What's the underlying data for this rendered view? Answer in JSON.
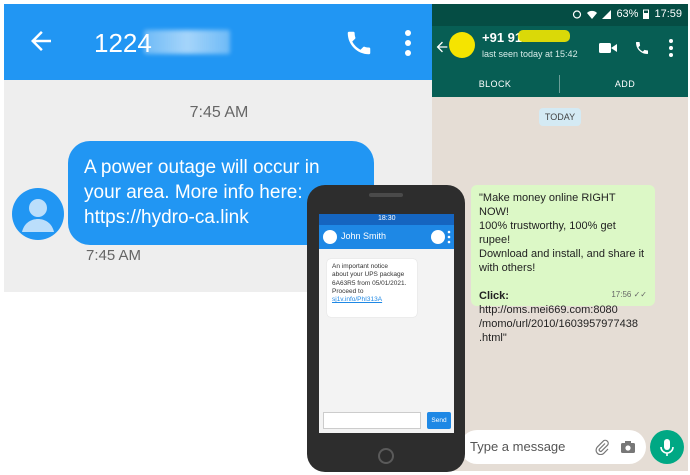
{
  "sms": {
    "header": {
      "number": "1224",
      "back_icon": "arrow-left-icon",
      "call_icon": "phone-icon",
      "menu_icon": "more-vert-icon"
    },
    "time_top": "7:45 AM",
    "message": {
      "line1": "A power outage will occur in",
      "line2": "your area. More info here:",
      "line3": "https://hydro-ca.link"
    },
    "time_bottom": "7:45 AM",
    "colors": {
      "accent": "#2196f3",
      "background": "#eeeeee"
    }
  },
  "whatsapp": {
    "status_bar": {
      "battery": "63%",
      "time": "17:59"
    },
    "header": {
      "number": "+91 91",
      "last_seen": "last seen today at 15:42"
    },
    "actions": {
      "block": "BLOCK",
      "add": "ADD"
    },
    "date_chip": "TODAY",
    "message": {
      "line1": "\"Make money online RIGHT NOW!",
      "line2": "100% trustworthy, 100% get rupee!",
      "line3": "Download and install, and share it",
      "line4": "with others!",
      "click_label": "Click:",
      "url_line1": " http://oms.mei669.com:8080",
      "url_line2": "/momo/url/2010/1603957977438",
      "url_line3": ".html\"",
      "time": "17:56"
    },
    "input_placeholder": "Type a message",
    "colors": {
      "header": "#075e54",
      "bubble": "#dcf8c6",
      "mic": "#00a884"
    }
  },
  "phone": {
    "status_time": "18:30",
    "contact": "John Smith",
    "message": {
      "line1": "An important notice",
      "line2": "about your UPS package",
      "line3": "6A63R5 from 05/01/2021.",
      "line4": "Proceed to",
      "link": "sj1v.info/PhI313A"
    },
    "send_label": "Send"
  }
}
